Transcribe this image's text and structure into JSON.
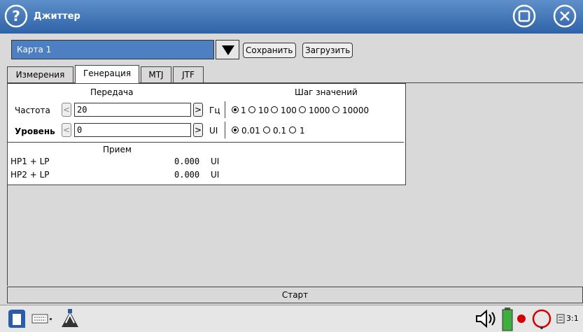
{
  "window": {
    "title": "Джиттер"
  },
  "profile": {
    "value": "Карта 1",
    "save_label": "Сохранить",
    "load_label": "Загрузить"
  },
  "tabs": [
    {
      "label": "Измерения",
      "active": false
    },
    {
      "label": "Генерация",
      "active": true
    },
    {
      "label": "MTJ",
      "active": false
    },
    {
      "label": "JTF",
      "active": false
    }
  ],
  "transmit": {
    "header": "Передача",
    "step_header": "Шаг значений",
    "frequency": {
      "label": "Частота",
      "value": "20",
      "unit": "Гц",
      "steps": [
        "1",
        "10",
        "100",
        "1000",
        "10000"
      ],
      "selected_step": "1"
    },
    "level": {
      "label": "Уровень",
      "value": "0",
      "unit": "UI",
      "steps": [
        "0.01",
        "0.1",
        "1"
      ],
      "selected_step": "0.01"
    }
  },
  "receive": {
    "header": "Прием",
    "rows": [
      {
        "label": "HP1 + LP",
        "value": "0.000",
        "unit": "UI"
      },
      {
        "label": "HP2 + LP",
        "value": "0.000",
        "unit": "UI"
      }
    ]
  },
  "start_label": "Старт",
  "taskbar": {
    "indicator_text": "3:1"
  },
  "colors": {
    "titlebar": "#3a6db3",
    "profile_bg": "#4d7fc2",
    "battery": "#3fae3f",
    "status_dot": "#d40000"
  }
}
